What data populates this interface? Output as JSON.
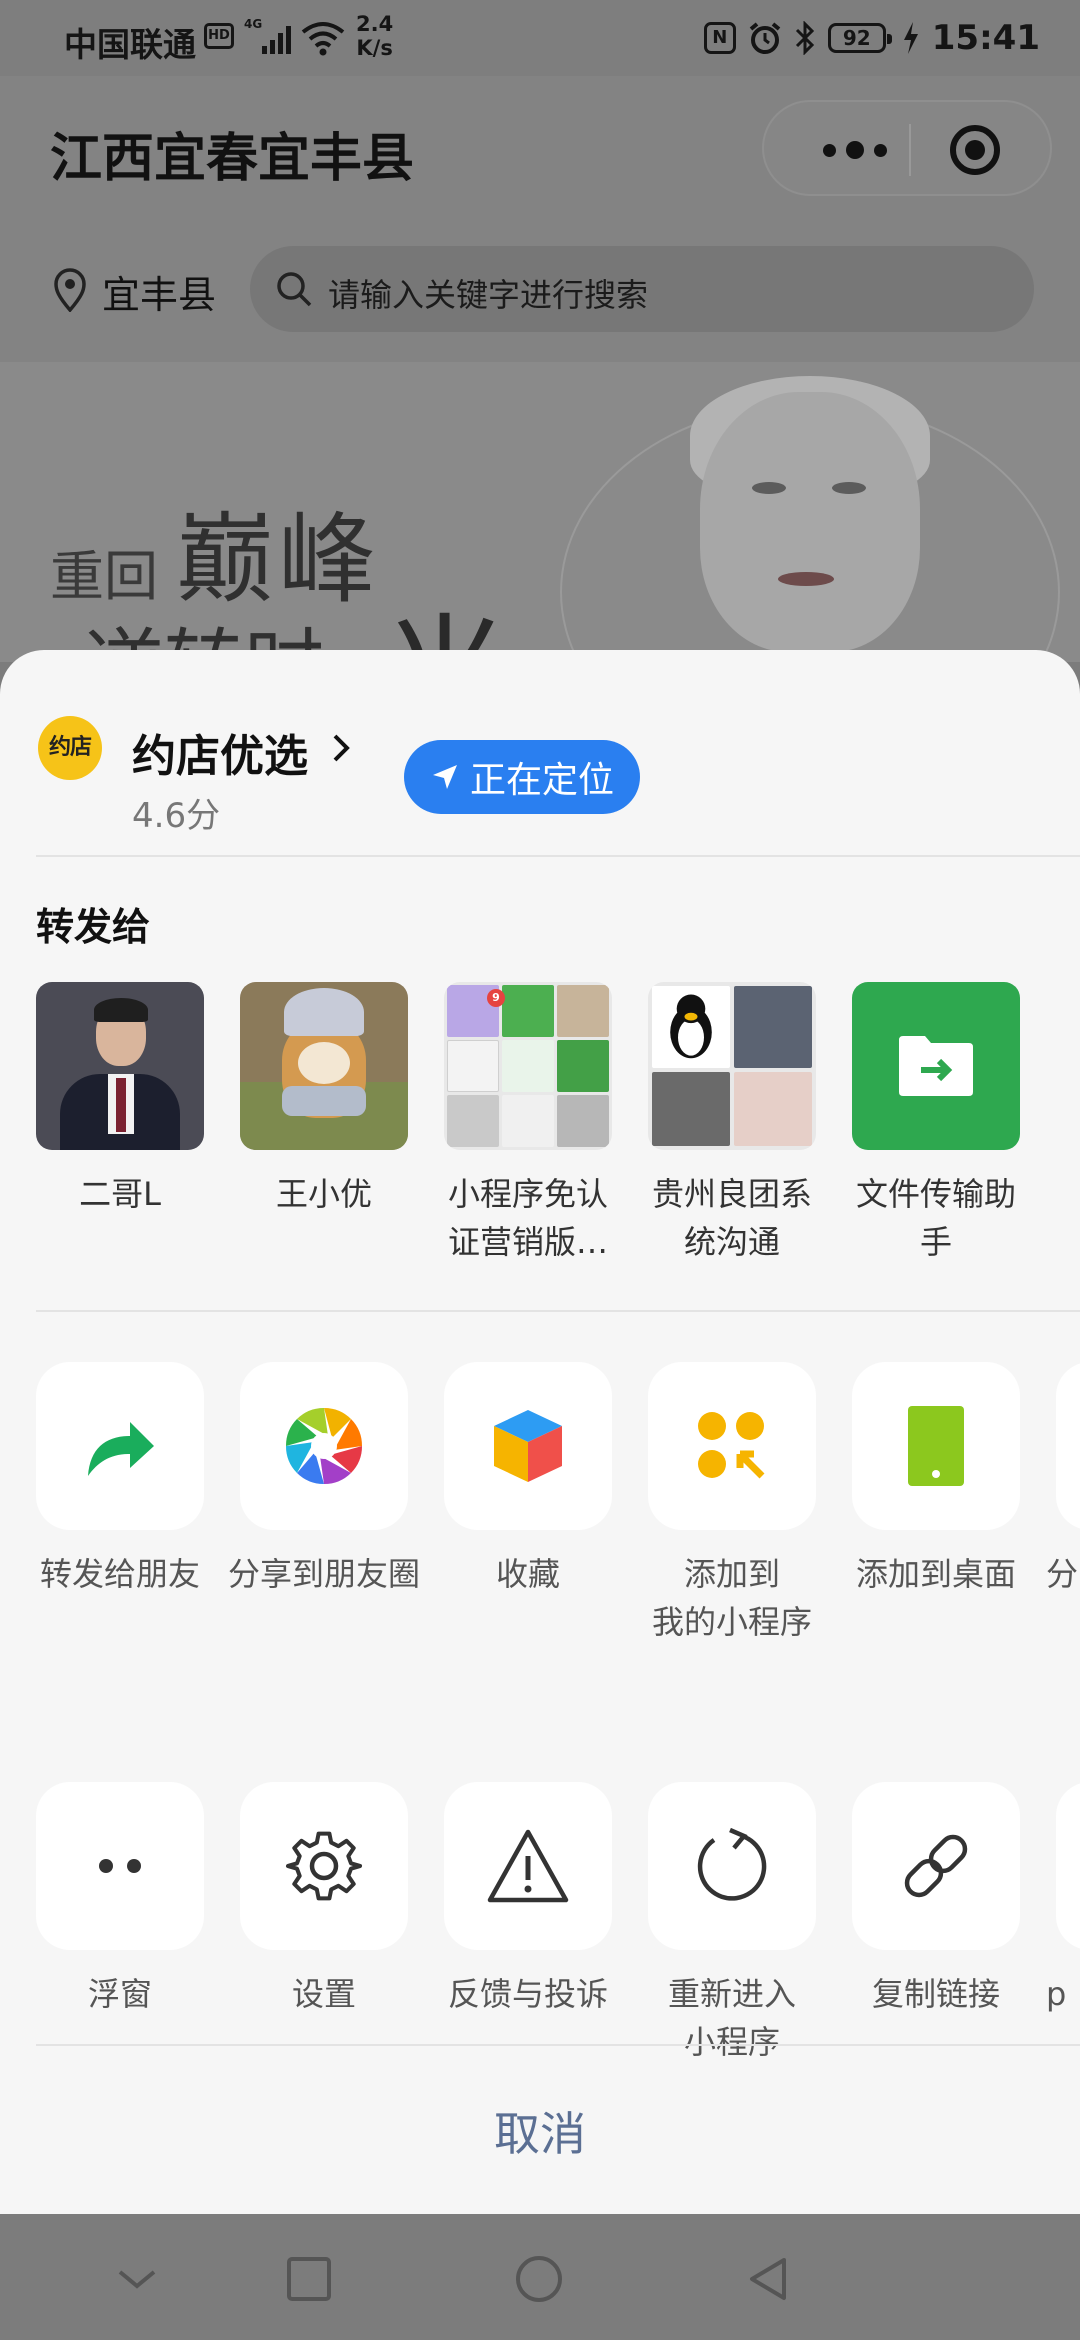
{
  "status_bar": {
    "carrier": "中国联通",
    "hd_badge": "HD",
    "network": "4G",
    "speed_value": "2.4",
    "speed_unit": "K/s",
    "battery": "92",
    "time": "15:41"
  },
  "page": {
    "title": "江西宜春宜丰县",
    "location": "宜丰县",
    "search_placeholder": "请输入关键字进行搜索",
    "banner": {
      "line1": "重回",
      "line2": "巅峰",
      "line3": "逆转时",
      "line4": "光"
    }
  },
  "sheet": {
    "app_logo_text": "约店",
    "app_name": "约店优选",
    "app_rating": "4.6分",
    "locating_label": "正在定位",
    "forward_title": "转发给",
    "contacts": [
      {
        "name": "二哥L"
      },
      {
        "name": "王小优"
      },
      {
        "name": "小程序免认证营销版…"
      },
      {
        "name": "贵州良团系统沟通"
      },
      {
        "name": "文件传输助手"
      }
    ],
    "group_badge": "9",
    "actions_row1": [
      {
        "label": "转发给朋友",
        "icon": "share-forward-icon"
      },
      {
        "label": "分享到朋友圈",
        "icon": "moments-icon"
      },
      {
        "label": "收藏",
        "icon": "favorite-cube-icon"
      },
      {
        "label": "添加到\n我的小程序",
        "icon": "add-miniprogram-icon"
      },
      {
        "label": "添加到桌面",
        "icon": "add-desktop-icon"
      },
      {
        "label": "分",
        "icon": "partial-icon"
      }
    ],
    "actions_row2": [
      {
        "label": "浮窗",
        "icon": "float-window-icon"
      },
      {
        "label": "设置",
        "icon": "gear-icon"
      },
      {
        "label": "反馈与投诉",
        "icon": "warning-icon"
      },
      {
        "label": "重新进入\n小程序",
        "icon": "reload-icon"
      },
      {
        "label": "复制链接",
        "icon": "link-icon"
      },
      {
        "label": "p",
        "icon": "partial-icon"
      }
    ],
    "cancel_label": "取消"
  },
  "colors": {
    "accent_blue": "#2a7ff0",
    "wechat_green": "#2ea84f",
    "sheet_bg": "#f6f6f6",
    "cancel_text": "#5b6f93"
  }
}
